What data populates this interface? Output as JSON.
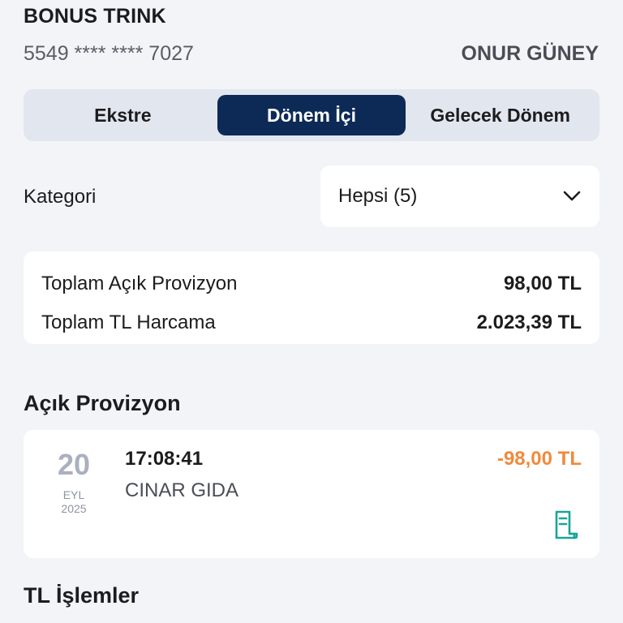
{
  "card": {
    "name": "BONUS TRINK",
    "number": "5549 **** **** 7027",
    "owner": "ONUR GÜNEY"
  },
  "tabs": [
    {
      "label": "Ekstre",
      "active": false
    },
    {
      "label": "Dönem İçi",
      "active": true
    },
    {
      "label": "Gelecek Dönem",
      "active": false
    }
  ],
  "category": {
    "label": "Kategori",
    "value": "Hepsi (5)",
    "icon": "chevron-down-icon"
  },
  "summary": {
    "open_provision_label": "Toplam Açık Provizyon",
    "open_provision_value": "98,00 TL",
    "tl_spend_label": "Toplam TL Harcama",
    "tl_spend_value": "2.023,39 TL"
  },
  "open_provision": {
    "title": "Açık Provizyon",
    "transactions": [
      {
        "day": "20",
        "month": "EYL",
        "year": "2025",
        "time": "17:08:41",
        "merchant": "CINAR GIDA",
        "amount": "-98,00 TL",
        "icon": "receipt-icon"
      }
    ]
  },
  "tl_transactions": {
    "title": "TL İşlemler"
  },
  "colors": {
    "background": "#f3f4f8",
    "active_tab": "#0d2a56",
    "negative_amount": "#f08a3c",
    "receipt_icon": "#1aa39a"
  }
}
